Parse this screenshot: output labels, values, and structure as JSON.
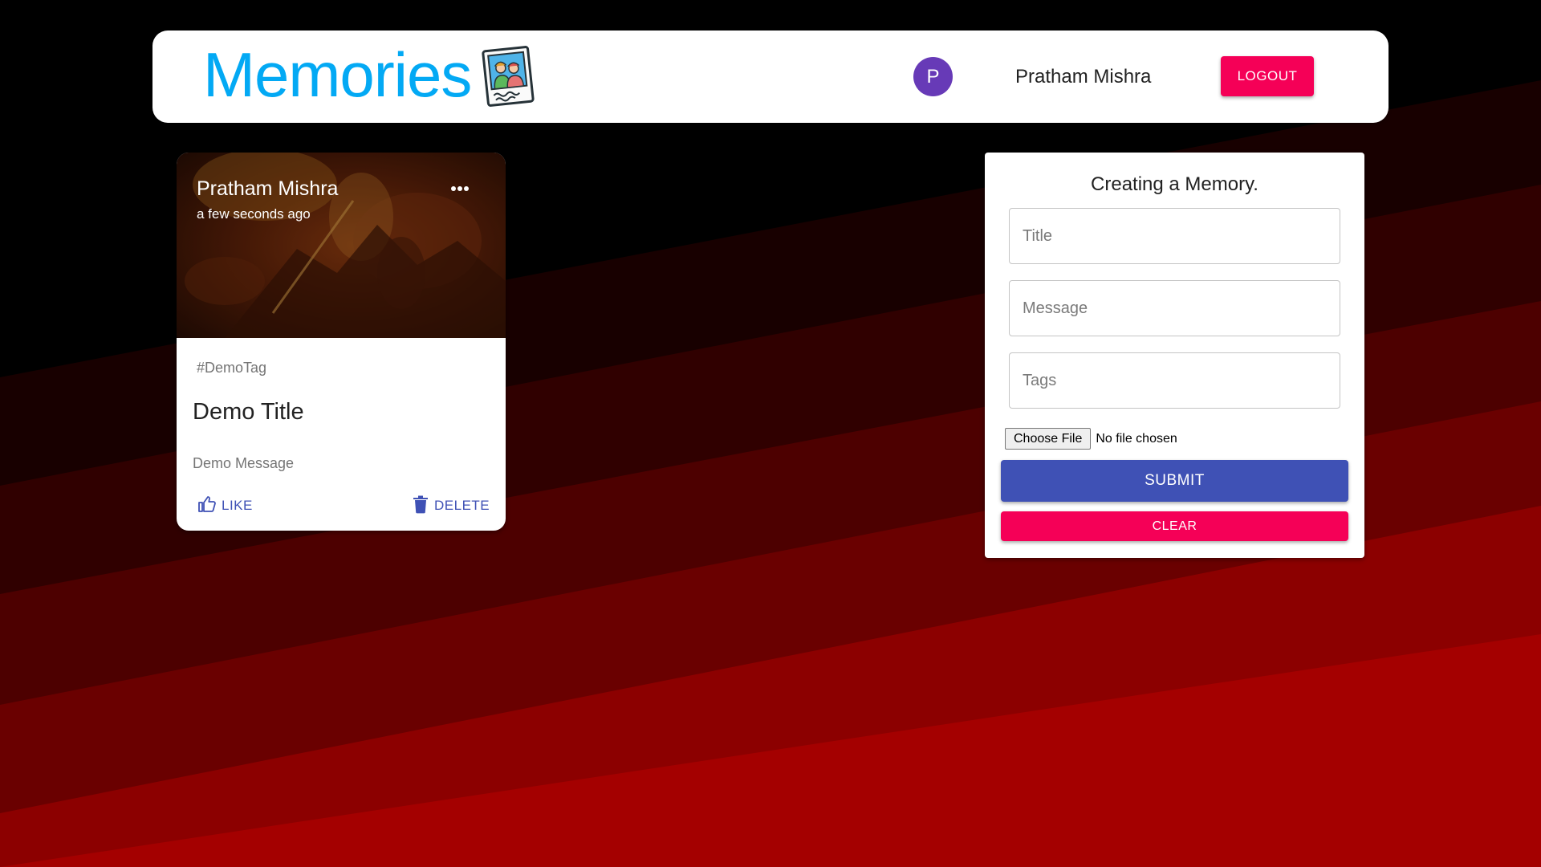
{
  "app": {
    "title": "Memories",
    "logo_icon": "memories-photo-icon",
    "brand_color": "#03a9f4"
  },
  "user": {
    "avatar_letter": "P",
    "name": "Pratham Mishra",
    "avatar_color": "#673ab7"
  },
  "header": {
    "logout_label": "LOGOUT"
  },
  "posts": [
    {
      "creator": "Pratham Mishra",
      "time": "a few seconds ago",
      "tags": "#DemoTag",
      "title": "Demo Title",
      "message": "Demo Message",
      "like_label": "LIKE",
      "delete_label": "DELETE",
      "more_icon": "more-horizontal-icon",
      "like_icon": "thumb-up-icon",
      "delete_icon": "trash-icon"
    }
  ],
  "form": {
    "heading": "Creating a Memory.",
    "title_placeholder": "Title",
    "message_placeholder": "Message",
    "tags_placeholder": "Tags",
    "file_button": "Choose File",
    "file_status": "No file chosen",
    "submit_label": "SUBMIT",
    "clear_label": "CLEAR"
  },
  "colors": {
    "primary": "#3f51b5",
    "secondary": "#f50057",
    "background_dark": "#000000",
    "background_red": "#b30000"
  }
}
